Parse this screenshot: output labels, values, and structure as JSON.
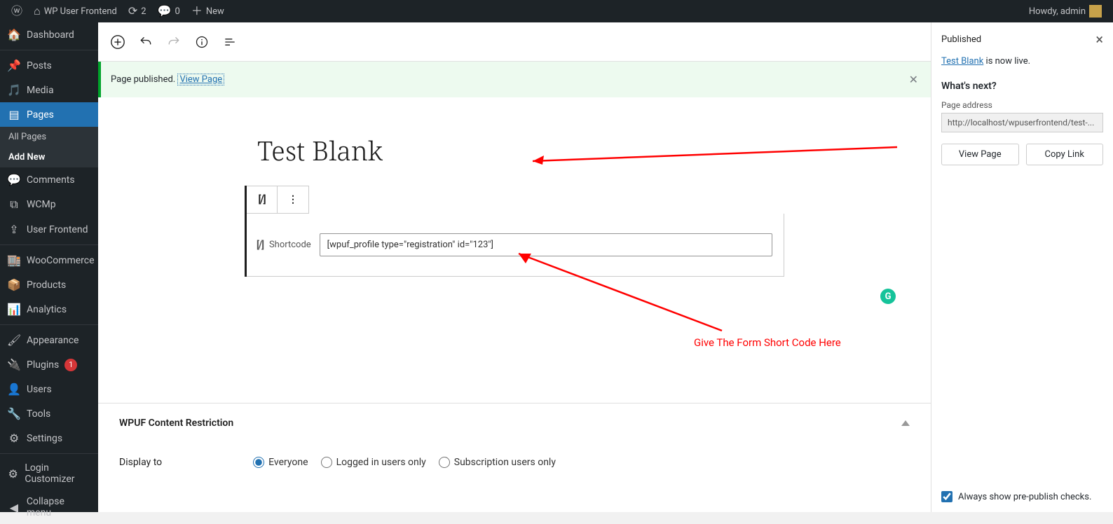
{
  "adminbar": {
    "site": "WP User Frontend",
    "updates": "2",
    "comments": "0",
    "new": "New",
    "howdy": "Howdy, admin"
  },
  "sidebar": {
    "dashboard": "Dashboard",
    "posts": "Posts",
    "media": "Media",
    "pages": "Pages",
    "sub_all": "All Pages",
    "sub_add": "Add New",
    "comments_label": "Comments",
    "wcmp": "WCMp",
    "userfrontend": "User Frontend",
    "woocommerce": "WooCommerce",
    "products": "Products",
    "analytics": "Analytics",
    "appearance": "Appearance",
    "plugins": "Plugins",
    "plugins_badge": "1",
    "users": "Users",
    "tools": "Tools",
    "settings": "Settings",
    "login_custom": "Login Customizer",
    "collapse": "Collapse menu"
  },
  "notice": {
    "published": "Page published.",
    "view": "View Page"
  },
  "editor": {
    "title": "Test Blank",
    "shortcode_label": "Shortcode",
    "shortcode_value": "[wpuf_profile type=\"registration\" id=\"123\"]"
  },
  "annotations": {
    "shortcode_hint": "Give The Form Short Code Here"
  },
  "restrict": {
    "heading": "WPUF Content Restriction",
    "display_to": "Display to",
    "opt_everyone": "Everyone",
    "opt_logged": "Logged in users only",
    "opt_subscription": "Subscription users only"
  },
  "panel": {
    "status": "Published",
    "live_link": "Test Blank",
    "live_suffix": " is now live.",
    "whats_next": "What's next?",
    "addr_label": "Page address",
    "addr_value": "http://localhost/wpuserfrontend/test-...",
    "view_page": "View Page",
    "copy_link": "Copy Link",
    "prepublish": "Always show pre-publish checks."
  }
}
